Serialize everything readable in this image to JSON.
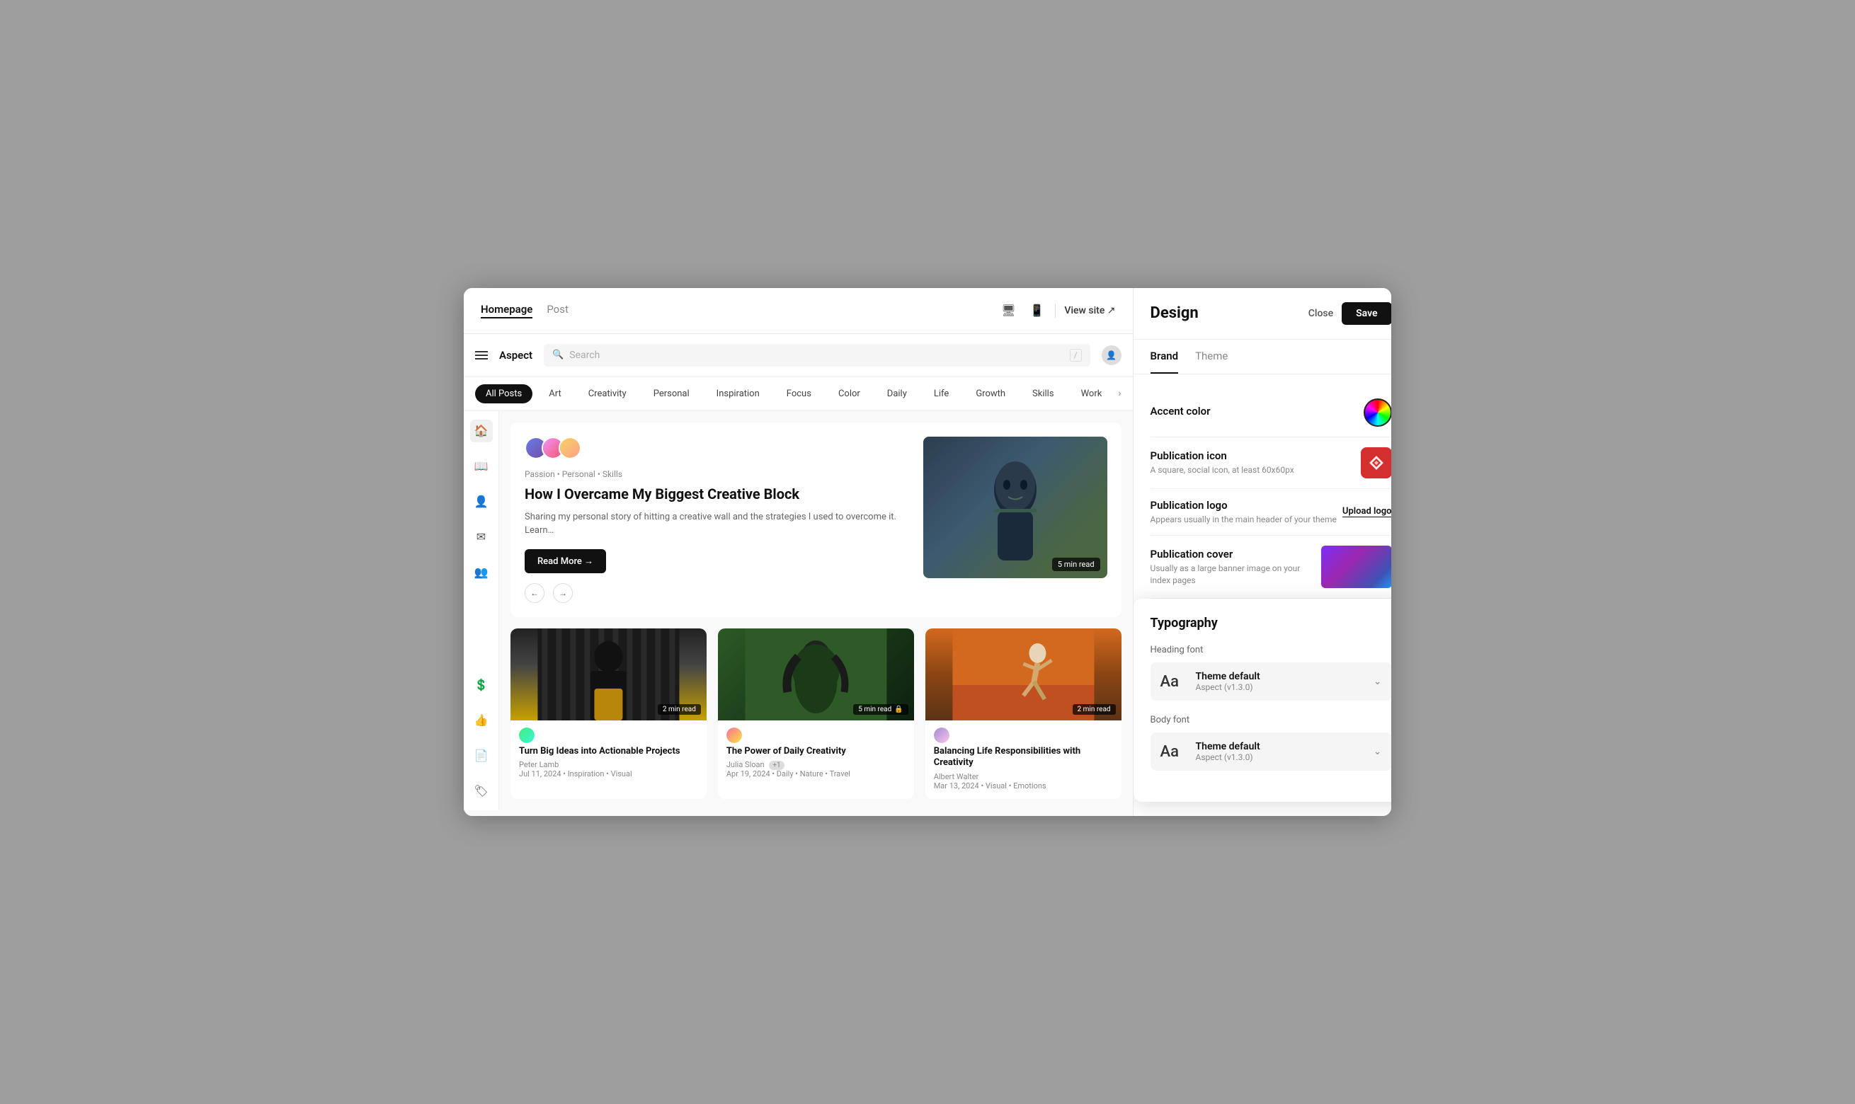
{
  "topBar": {
    "tabs": [
      {
        "label": "Homepage",
        "active": true
      },
      {
        "label": "Post",
        "active": false
      }
    ],
    "viewSite": "View site ↗",
    "icons": {
      "desktop": "🖥",
      "mobile": "📱"
    }
  },
  "siteNav": {
    "logo": "Aspect",
    "search": {
      "placeholder": "Search",
      "shortcut": "/"
    }
  },
  "filterTabs": {
    "items": [
      {
        "label": "All Posts",
        "active": true
      },
      {
        "label": "Art",
        "active": false
      },
      {
        "label": "Creativity",
        "active": false
      },
      {
        "label": "Personal",
        "active": false
      },
      {
        "label": "Inspiration",
        "active": false
      },
      {
        "label": "Focus",
        "active": false
      },
      {
        "label": "Color",
        "active": false
      },
      {
        "label": "Daily",
        "active": false
      },
      {
        "label": "Life",
        "active": false
      },
      {
        "label": "Growth",
        "active": false
      },
      {
        "label": "Skills",
        "active": false
      },
      {
        "label": "Work",
        "active": false
      }
    ]
  },
  "heroCard": {
    "tags": "Passion • Personal • Skills",
    "title": "How I Overcame My Biggest Creative Block",
    "description": "Sharing my personal story of hitting a creative wall and the strategies I used to overcome it. Learn…",
    "readMoreBtn": "Read More →",
    "readTime": "5 min read"
  },
  "postGrid": [
    {
      "id": 1,
      "title": "Turn Big Ideas into Actionable Projects",
      "author": "Peter Lamb",
      "meta": "Jul 11, 2024 • Inspiration • Visual",
      "readTime": "2 min read",
      "locked": false
    },
    {
      "id": 2,
      "title": "The Power of Daily Creativity",
      "author": "Julia Sloan",
      "authorBadge": "+1",
      "meta": "Apr 19, 2024 • Daily • Nature • Travel",
      "readTime": "5 min read",
      "locked": true
    },
    {
      "id": 3,
      "title": "Balancing Life Responsibilities with Creativity",
      "author": "Albert Walter",
      "meta": "Mar 13, 2024 • Visual • Emotions",
      "readTime": "2 min read",
      "locked": false
    }
  ],
  "designPanel": {
    "title": "Design",
    "closeBtn": "Close",
    "saveBtn": "Save",
    "tabs": [
      {
        "label": "Brand",
        "active": true
      },
      {
        "label": "Theme",
        "active": false
      }
    ],
    "brand": {
      "accentColor": {
        "label": "Accent color"
      },
      "publicationIcon": {
        "label": "Publication icon",
        "desc": "A square, social icon, at least 60x60px"
      },
      "publicationLogo": {
        "label": "Publication logo",
        "desc": "Appears usually in the main header of your theme",
        "uploadBtn": "Upload logo"
      },
      "publicationCover": {
        "label": "Publication cover",
        "desc": "Usually as a large banner image on your index pages"
      }
    },
    "typography": {
      "title": "Typography",
      "headingFont": {
        "label": "Heading font",
        "name": "Theme default",
        "sub": "Aspect (v1.3.0)"
      },
      "bodyFont": {
        "label": "Body font",
        "name": "Theme default",
        "sub": "Aspect (v1.3.0)"
      }
    }
  }
}
